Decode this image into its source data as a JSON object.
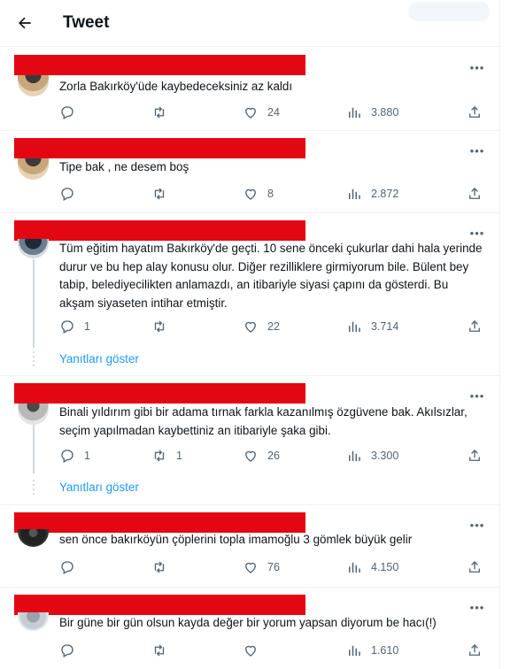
{
  "header": {
    "title": "Tweet",
    "back_icon": "arrow-left-icon"
  },
  "colors": {
    "accent": "#1d9bf0",
    "muted": "#536471",
    "redaction": "#e30613"
  },
  "tweets": [
    {
      "text": "Zorla Bakırköy'üde kaybedeceksiniz az kaldı",
      "reply": "",
      "retweet": "",
      "like": "24",
      "views": "3.880"
    },
    {
      "text": "Tipe bak , ne desem boş",
      "reply": "",
      "retweet": "",
      "like": "8",
      "views": "2.872"
    },
    {
      "text": "Tüm eğitim hayatım Bakırköy'de geçti. 10 sene önceki çukurlar dahi hala yerinde durur ve bu hep alay konusu olur. Diğer rezilliklere girmiyorum bile. Bülent bey tabip, belediyecilikten anlamazdı, an itibariyle siyasi çapını da gösterdi. Bu akşam siyaseten intihar etmiştir.",
      "reply": "1",
      "retweet": "",
      "like": "22",
      "views": "3.714",
      "show_replies": "Yanıtları göster"
    },
    {
      "text": "Binali yıldırım gibi bir adama tırnak farkla kazanılmış özgüvene bak. Akılsızlar, seçim yapılmadan kaybettiniz an itibariyle şaka gibi.",
      "reply": "1",
      "retweet": "1",
      "like": "26",
      "views": "3.300",
      "show_replies": "Yanıtları göster"
    },
    {
      "text": "sen önce bakırköyün çöplerini topla imamoğlu 3 gömlek büyük gelir",
      "reply": "",
      "retweet": "",
      "like": "76",
      "views": "4.150"
    },
    {
      "text": "Bir güne bir gün olsun kayda değer bir yorum yapsan diyorum be hacı(!)",
      "reply": "",
      "retweet": "",
      "like": "",
      "views": "1.610"
    }
  ],
  "icons": {
    "more": "more-dots-icon",
    "reply": "reply-icon",
    "retweet": "retweet-icon",
    "like": "heart-icon",
    "views": "views-icon",
    "share": "share-icon"
  }
}
